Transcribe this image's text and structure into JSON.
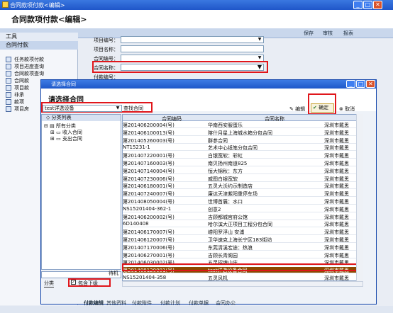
{
  "window": {
    "title": "合同款项付款<编辑>",
    "header": "合同款项付款<编辑>"
  },
  "toolbar": {
    "items": [
      "保存",
      "审核",
      "报表"
    ]
  },
  "left_panel": {
    "section1": "工具",
    "section2": "合同付款",
    "items": [
      "任务款项付款",
      "项目进度查询",
      "合同款项查询",
      "合同款",
      "项目款",
      "非承",
      "款项",
      "项目房"
    ]
  },
  "form": {
    "labels": [
      "项目编号：",
      "项目名称：",
      "合同编号：",
      "合同名称：",
      "付款编号："
    ]
  },
  "dialog": {
    "title": "请选择合同",
    "heading": "请选择合同",
    "search_value": "test详选设备",
    "search_button": "查找合同",
    "edit_label": "编辑",
    "ok_label": "确定",
    "cancel_label": "取消",
    "tree": {
      "header": "分类列表",
      "root": "所有分类",
      "children": [
        "收入合同",
        "支出合同"
      ]
    },
    "bottom_tab": "分类",
    "checkbox_label": "包含下级",
    "side_label": "待机",
    "columns": [
      "合同编码",
      "合同名称",
      ""
    ],
    "rows": [
      [
        "第201406200004(号)",
        "华南西安服蛋乐",
        "深圳市戴思"
      ],
      [
        "第201406100013(号)",
        "喀什月星上海城水箱分包合同",
        "深圳市戴思"
      ],
      [
        "第201405260003(号)",
        "群参合同",
        "深圳市戴思"
      ],
      [
        "NT15231-1",
        "艺术中心纸笔分包合同",
        "深圳市戴思"
      ],
      [
        "第201407220001(号)",
        "白银宽软：彩虹",
        "深圳市戴思"
      ],
      [
        "第201407160003(号)",
        "南贝扬州南道825",
        "深圳市戴思"
      ],
      [
        "第201407140004(号)",
        "恒大锦秋：东方",
        "深圳市戴思"
      ],
      [
        "第201407230006(号)",
        "威图白银宽软",
        "深圳市戴思"
      ],
      [
        "第201406180001(号)",
        "五灵大沃约示制造店",
        "深圳市戴思"
      ],
      [
        "第201407240007(号)",
        "廉达天津紫阳重停车场",
        "深圳市戴思"
      ],
      [
        "第201408050004(号)",
        "世博首展：水口",
        "深圳市戴思"
      ],
      [
        "NS15201404-362-1",
        "创意2",
        "深圳市戴思"
      ],
      [
        "第201406200002(号)",
        "吉顾都城官府公馆",
        "深圳市戴思"
      ],
      [
        "6D140408",
        "哈尔滨大正项目工程分包合同",
        "深圳市戴思"
      ],
      [
        "第201406170007(号)",
        "崂阳罗浮山 安浦",
        "深圳市戴思"
      ],
      [
        "第201406120007(号)",
        "卫华速克上海长宁区183街坊",
        "深圳市戴思"
      ],
      [
        "第201407170006(号)",
        "东莞清溪宏途：热浪",
        "深圳市戴思"
      ],
      [
        "第201406270001(号)",
        "吉顾长青阁园",
        "深圳市戴思"
      ],
      [
        "第201406030002(号)",
        "五灵招魂山庄",
        "深圳市戴思"
      ],
      [
        "第201408120001(号)",
        "test详选设备合同",
        "深圳市戴思"
      ],
      [
        "NS15201404-358",
        "五灵风机",
        "深圳市戴思"
      ]
    ],
    "selected_row": 19
  },
  "bottom_tabs": [
    "付款编辑",
    "其他资料",
    "付款附件",
    "付款计划",
    "付款单据",
    "合同办公"
  ]
}
